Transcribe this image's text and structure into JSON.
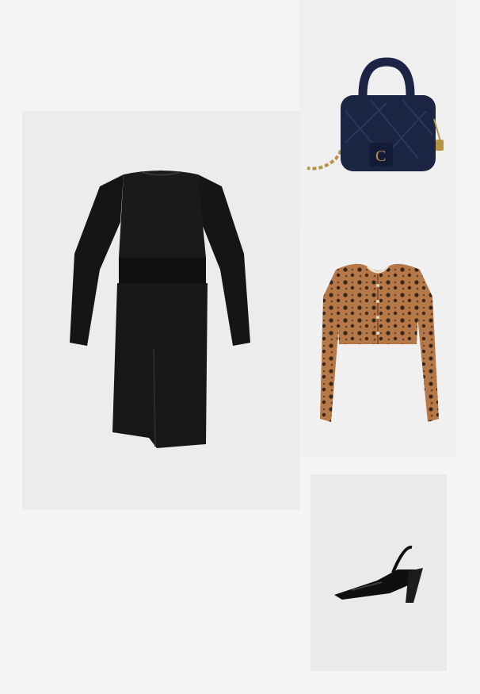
{
  "collage": {
    "background_color": "#f5f5f5",
    "items": [
      {
        "name": "black-dress-image",
        "color": "#121212"
      },
      {
        "name": "navy-handbag-image",
        "color": "#1c2444",
        "accent": "#b59448"
      },
      {
        "name": "leopard-cardigan-image",
        "color": "#b57848",
        "accent": "#3a2416"
      },
      {
        "name": "black-slingback-shoe-image",
        "color": "#0f0f0f"
      }
    ]
  }
}
